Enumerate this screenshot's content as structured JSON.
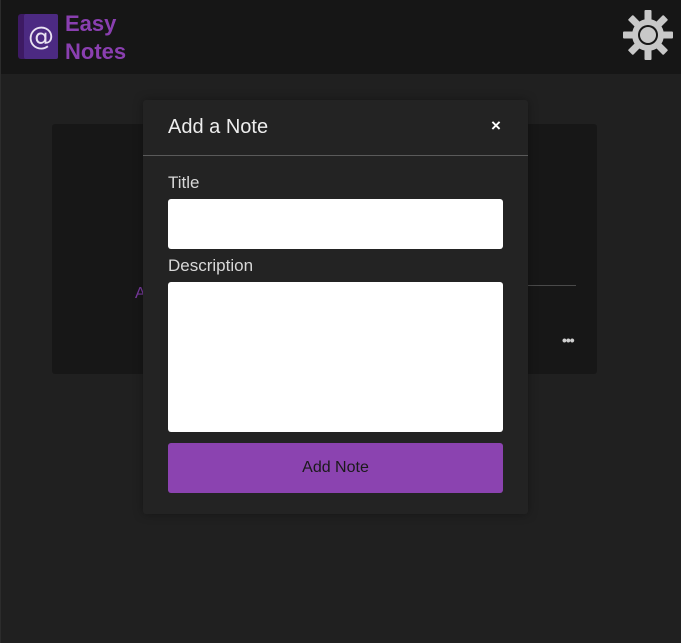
{
  "header": {
    "app_name_line1": "Easy",
    "app_name_line2": "Notes",
    "logo_icon": "at-sign-book-icon",
    "logo_glyph": "@",
    "theme_toggle_icon": "sun-icon"
  },
  "background_card": {
    "partial_text": "A",
    "more_label": "•••"
  },
  "modal": {
    "title": "Add a Note",
    "close_label": "×",
    "fields": {
      "title_label": "Title",
      "title_value": "",
      "description_label": "Description",
      "description_value": ""
    },
    "submit_label": "Add Note"
  },
  "colors": {
    "accent": "#8b43b0",
    "brand_text": "#8a3fb0",
    "background": "#202020",
    "header": "#161616",
    "modal": "#232323"
  }
}
